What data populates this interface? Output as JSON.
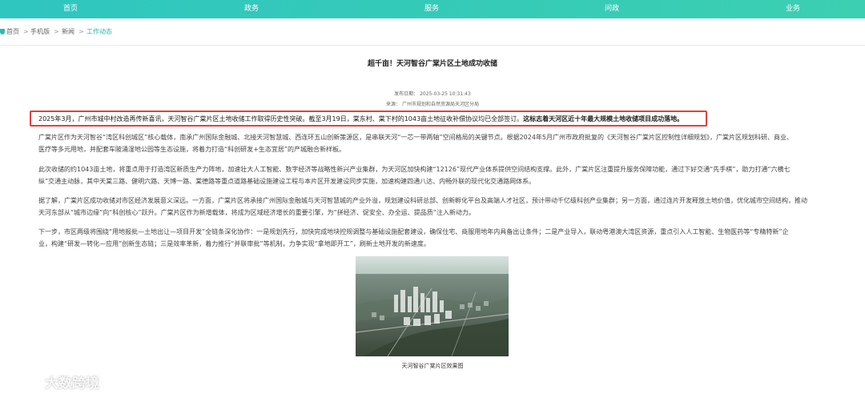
{
  "nav": {
    "items": [
      "首页",
      "政务",
      "服务",
      "问政",
      "业务"
    ]
  },
  "breadcrumb": {
    "items": [
      "首页",
      "手机版",
      "新闻",
      "工作动态"
    ],
    "separator": ">"
  },
  "article": {
    "title": "超千亩！天河智谷广棠片区土地成功收储",
    "publish_date": "发布日期：  2025-03-25 10:31:43",
    "source": "来源：  广州市规划和自然资源局天河区分局",
    "paragraphs": [
      "2025年3月，广州市城中村改造再传新喜讯，天河智谷广棠片区土地收储工作取得历史性突破。截至3月19日，棠东村、棠下村的1043亩土地征收补偿协议均已全部签订。",
      "这标志着天河区近十年最大规模土地收储项目成功落地。",
      "广棠片区作为天河智谷“湾区科创城区”核心载体，南承广州国际金融城、北接天河智慧城、西连环五山创新策源区，是串联天河“一芯一带两轴”空间格局的关键节点。根据2024年5月广州市政府批复的《天河智谷广棠片区控制性详细规划》，广棠片区规划科研、商业、",
      "医疗等多元用地，并配套车陂涌湿地公园等生态设施，将着力打造“科创研发+生态宜居”的产城融合新样板。",
      "此次收储的约1043亩土地，将重点用于打造湾区新质生产力阵地，加速壮大人工智能、数字经济等战略性新兴产业集群，为天河区加快构建“12126”现代产业体系提供空间结构支撑。此外，广棠片区注重提升服务保障功能，通过下好交通“先手棋”，助力打通“六横七",
      "纵”交通主动脉，其中天棠三路、健明六路、天博一路、棠德路等重点道路基础设施建设工程与本片区开发建设同步实施，加速构建四通八达、内畅外联的现代化交通路网体系。",
      "据了解，广棠片区成功收储对市区经济发展意义深远。一方面，广棠片区将承接广州国际金融城与天河智慧城的产业外溢，规划建设科研总部、创新孵化平台及高端人才社区，预计带动千亿级科创产业集群；另一方面，通过连片开发释放土地价值，优化城市空间结构，推动",
      "天河东部从“城市边缘”向“科创核心”跃升。广棠片区作为新增载体，将成为区域经济增长的重要引擎，为“拼经济、促安全、办全运、提品质”注入新动力。",
      "下一步，市区两级将围绕“用地报批—土地出让—项目开发”全链条深化协作：一是规划先行，加快完成地块控规调整与基础设施配套建设，确保住宅、商服用地年内具备出让条件；二是产业导入，联动粤港澳大湾区资源，重点引入人工智能、生物医药等“专精特新”企",
      "业，构建“研发—转化—应用”创新生态链；三是效率革新，着力推行“并联审批”等机制，力争实现“拿地即开工”，刷新土地开发的新速度。"
    ],
    "figure_caption": "天河智谷广棠片区效果图"
  },
  "watermark": {
    "text": "大数跨境"
  },
  "colors": {
    "nav_bg": "#35cab8",
    "highlight_border": "#e0413f",
    "breadcrumb_current": "#2fb0a8"
  }
}
